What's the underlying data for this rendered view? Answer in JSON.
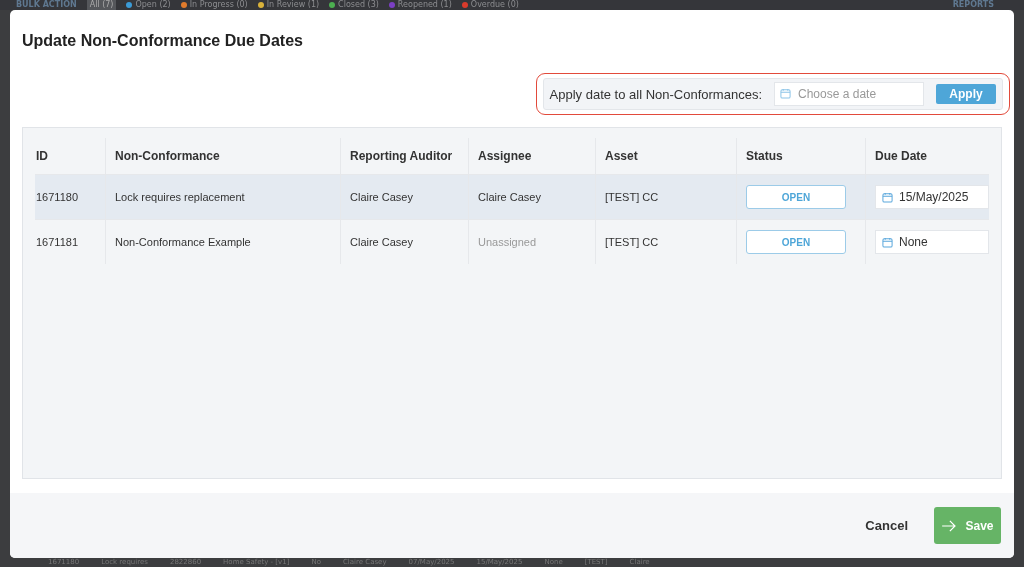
{
  "background": {
    "bulk_action": "BULK ACTION",
    "filters": [
      {
        "label": "All (7)",
        "selected": true
      },
      {
        "label": "Open (2)",
        "selected": false,
        "color": "#3b9bd6"
      },
      {
        "label": "In Progress (0)",
        "selected": false,
        "color": "#e07b2c"
      },
      {
        "label": "In Review (1)",
        "selected": false,
        "color": "#d9b23a"
      },
      {
        "label": "Closed (3)",
        "selected": false,
        "color": "#4caf50"
      },
      {
        "label": "Reopened (1)",
        "selected": false,
        "color": "#7b3fc4"
      },
      {
        "label": "Overdue (0)",
        "selected": false,
        "color": "#d93b2c"
      }
    ],
    "reports": "REPORTS",
    "row": [
      "1671180",
      "Lock requires",
      "2822860",
      "Home Safety - [v1]",
      "No",
      "Claire Casey",
      "07/May/2025",
      "15/May/2025",
      "None",
      "[TEST]",
      "Claire"
    ]
  },
  "dialog": {
    "title": "Update Non-Conformance Due Dates",
    "apply_bar": {
      "label": "Apply date to all Non-Conformances:",
      "placeholder": "Choose a date",
      "button": "Apply"
    },
    "table": {
      "columns": [
        "ID",
        "Non-Conformance",
        "Reporting Auditor",
        "Assignee",
        "Asset",
        "Status",
        "Due Date"
      ],
      "rows": [
        {
          "id": "1671180",
          "title": "Lock requires replacement",
          "auditor": "Claire Casey",
          "assignee": "Claire Casey",
          "assigned": true,
          "asset": "[TEST] CC",
          "status": {
            "kind": "open",
            "label": "OPEN"
          },
          "due": "15/May/2025",
          "selected": true
        },
        {
          "id": "1671181",
          "title": "Non-Conformance Example",
          "auditor": "Claire Casey",
          "assignee": "Unassigned",
          "assigned": false,
          "asset": "[TEST] CC",
          "status": {
            "kind": "open",
            "label": "OPEN"
          },
          "due": "None",
          "selected": false
        }
      ]
    },
    "buttons": {
      "cancel": "Cancel",
      "save": "Save"
    }
  }
}
